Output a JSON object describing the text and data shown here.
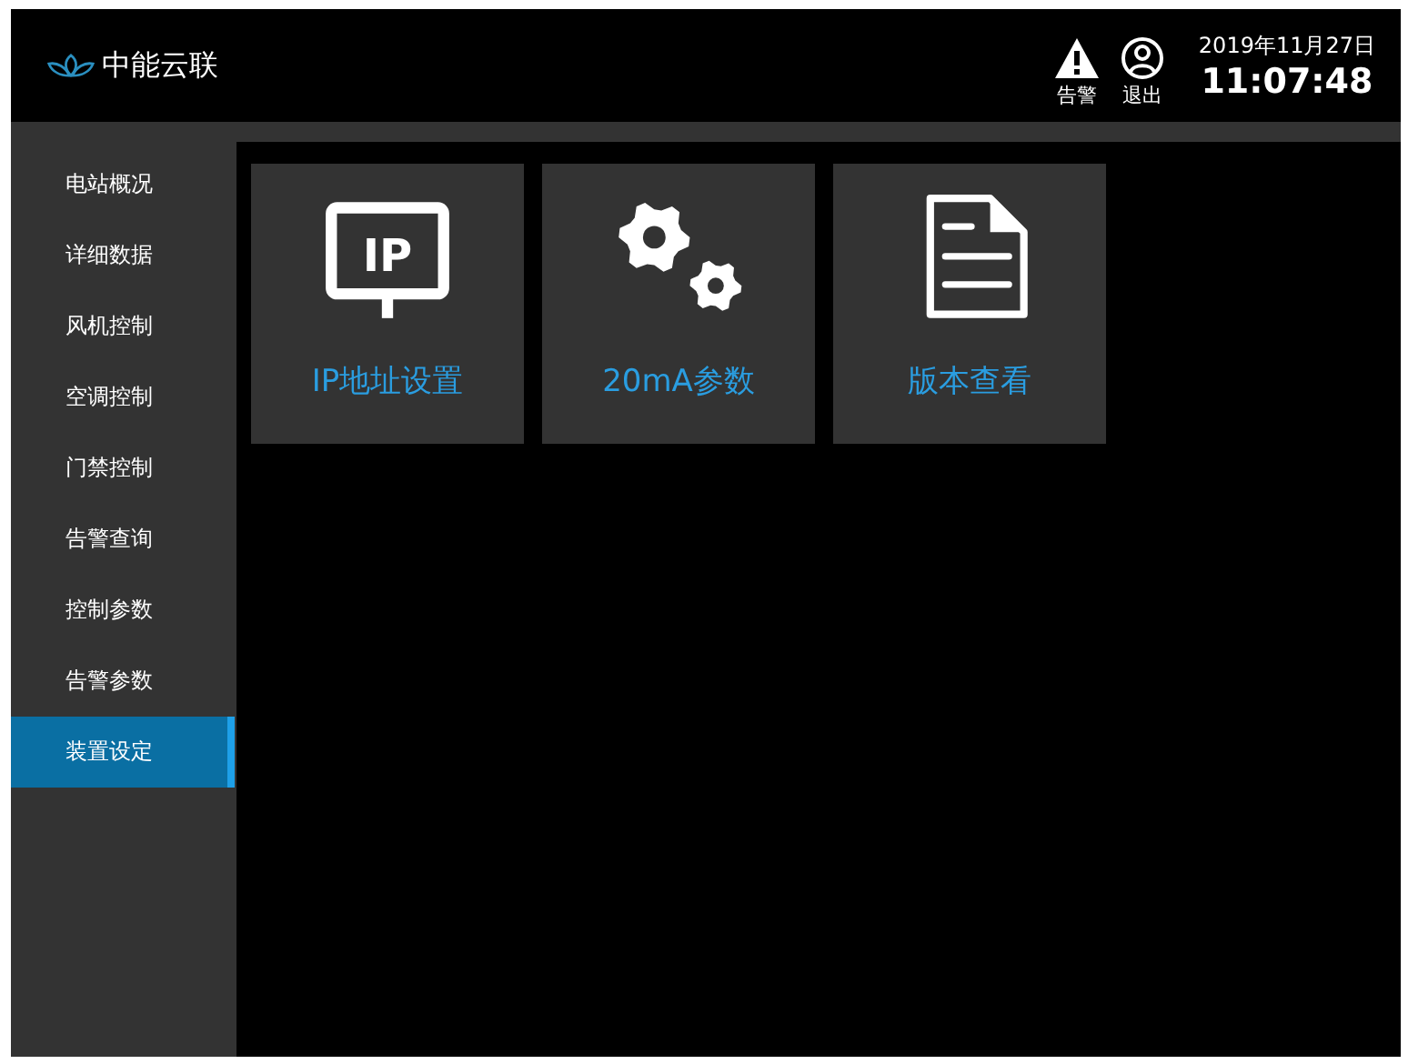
{
  "header": {
    "logo_text": "中能云联",
    "actions": [
      {
        "kind": "alarm",
        "label": "告警"
      },
      {
        "kind": "logout",
        "label": "退出"
      }
    ],
    "date": "2019年11月27日",
    "time": "11:07:48"
  },
  "sidebar": {
    "items": [
      {
        "label": "电站概况",
        "selected": false
      },
      {
        "label": "详细数据",
        "selected": false
      },
      {
        "label": "风机控制",
        "selected": false
      },
      {
        "label": "空调控制",
        "selected": false
      },
      {
        "label": "门禁控制",
        "selected": false
      },
      {
        "label": "告警查询",
        "selected": false
      },
      {
        "label": "控制参数",
        "selected": false
      },
      {
        "label": "告警参数",
        "selected": false
      },
      {
        "label": "装置设定",
        "selected": true
      }
    ]
  },
  "tiles": [
    {
      "kind": "ip",
      "icon_text": "IP",
      "label": "IP地址设置"
    },
    {
      "kind": "gears",
      "label": "20mA参数"
    },
    {
      "kind": "document",
      "label": "版本查看"
    }
  ]
}
